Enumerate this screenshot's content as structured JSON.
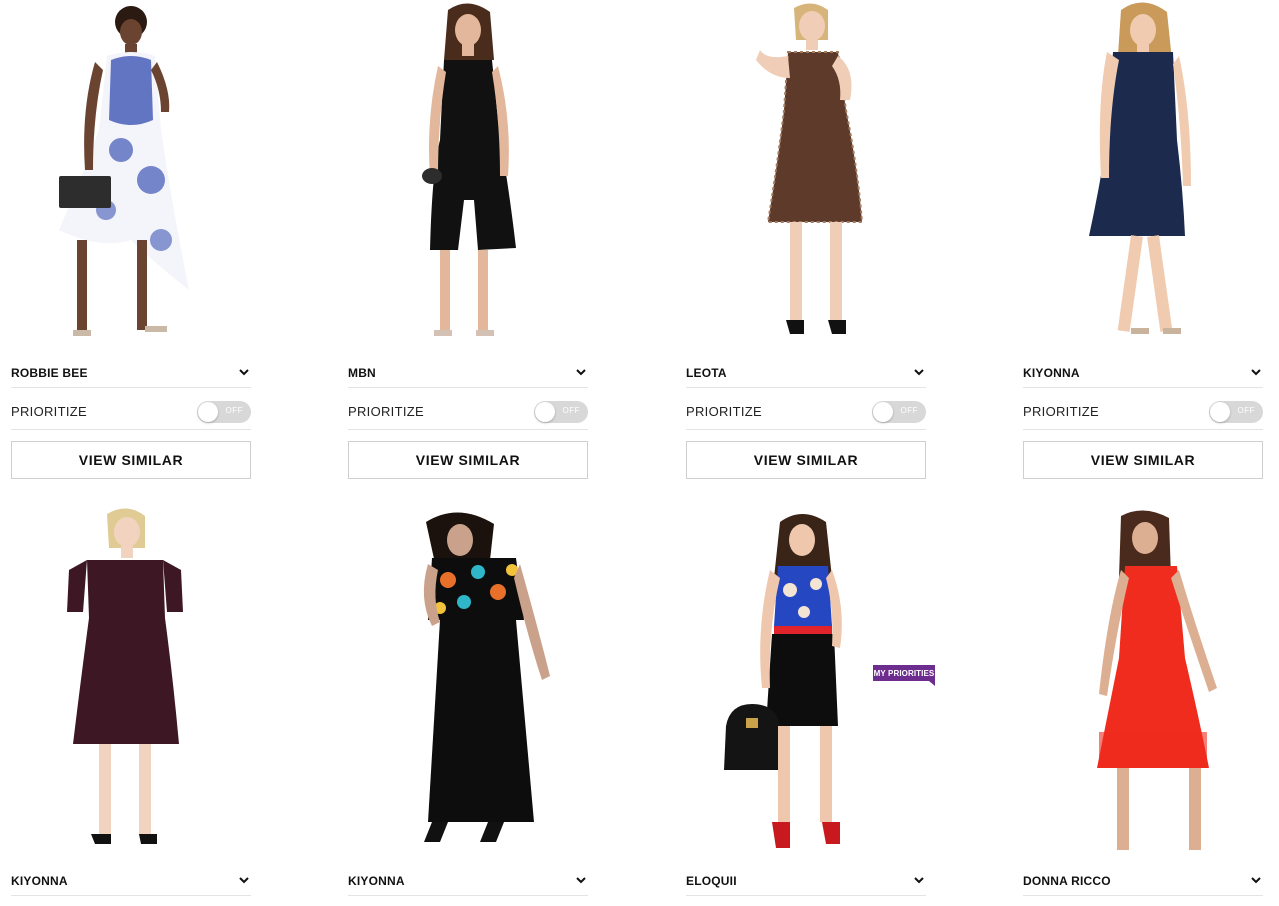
{
  "products": [
    {
      "brand": "ROBBIE BEE",
      "prioritize_label": "PRIORITIZE",
      "toggle_state": "OFF",
      "similar_label": "VIEW SIMILAR",
      "colors": {
        "dress": "#3d55b5",
        "accent": "#f4f4fb"
      }
    },
    {
      "brand": "MBN",
      "prioritize_label": "PRIORITIZE",
      "toggle_state": "OFF",
      "similar_label": "VIEW SIMILAR",
      "colors": {
        "dress": "#111111",
        "accent": "#111111"
      }
    },
    {
      "brand": "LEOTA",
      "prioritize_label": "PRIORITIZE",
      "toggle_state": "OFF",
      "similar_label": "VIEW SIMILAR",
      "colors": {
        "dress": "#5e3a2a",
        "accent": "#a47c60"
      }
    },
    {
      "brand": "KIYONNA",
      "prioritize_label": "PRIORITIZE",
      "toggle_state": "OFF",
      "similar_label": "VIEW SIMILAR",
      "colors": {
        "dress": "#1b2a4d",
        "accent": "#1b2a4d"
      }
    },
    {
      "brand": "KIYONNA",
      "colors": {
        "dress": "#3d1824",
        "accent": "#3d1824"
      }
    },
    {
      "brand": "KIYONNA",
      "colors": {
        "dress": "#0d0d0d",
        "accent": "#e8702a"
      }
    },
    {
      "brand": "ELOQUII",
      "colors": {
        "dress": "#0d0d0d",
        "accent": "#2548c2"
      }
    },
    {
      "brand": "DONNA RICCO",
      "colors": {
        "dress": "#ef2c1e",
        "accent": "#ef2c1e"
      }
    }
  ],
  "badge": {
    "label": "MY PRIORITIES",
    "color": "#6d2d8f"
  }
}
